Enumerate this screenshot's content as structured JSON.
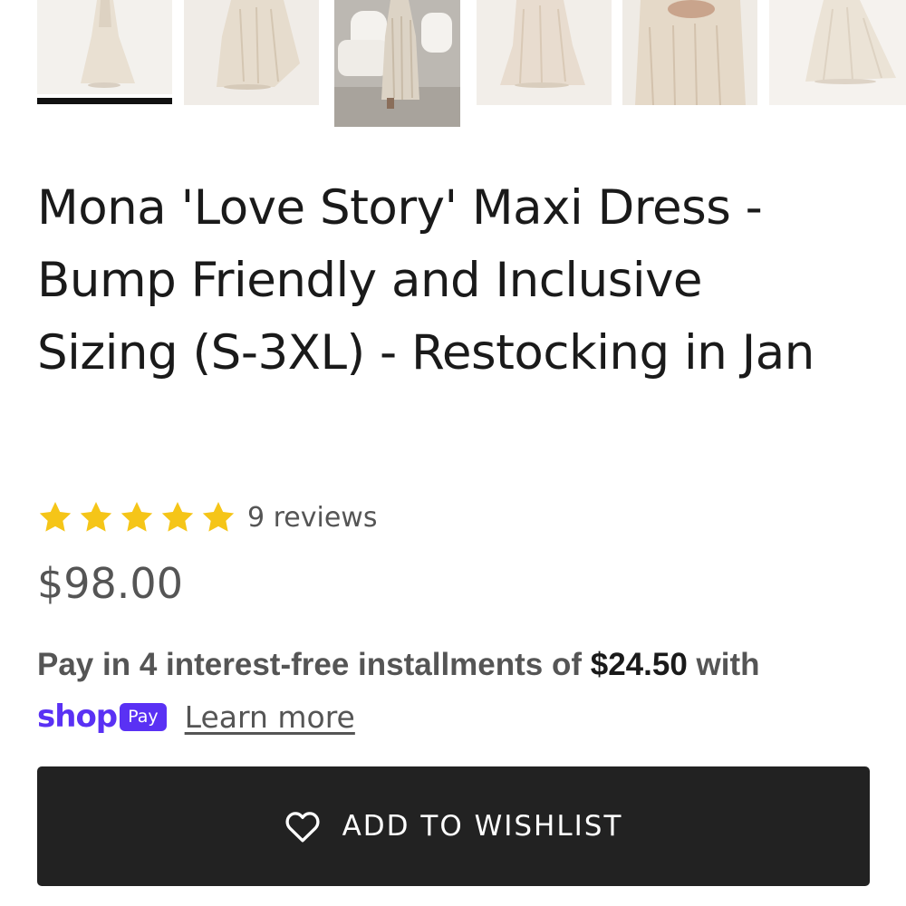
{
  "gallery": {
    "thumbnails": [
      {
        "alt": "thumbnail-1",
        "active": true
      },
      {
        "alt": "thumbnail-2",
        "active": false
      },
      {
        "alt": "thumbnail-3",
        "active": false
      },
      {
        "alt": "thumbnail-4",
        "active": false
      },
      {
        "alt": "thumbnail-5",
        "active": false
      },
      {
        "alt": "thumbnail-6",
        "active": false
      }
    ]
  },
  "product": {
    "title": "Mona 'Love Story' Maxi Dress - Bump Friendly and Inclusive Sizing (S-3XL) - Restocking in Jan",
    "rating": {
      "stars": 5,
      "max_stars": 5,
      "reviews_label": "9 reviews"
    },
    "price": "$98.00"
  },
  "installments": {
    "prefix": "Pay in 4 interest-free installments of",
    "amount": "$24.50",
    "suffix": "with",
    "shop_word": "shop",
    "pay_badge": "Pay",
    "learn_more": "Learn more"
  },
  "wishlist": {
    "label": "ADD TO WISHLIST",
    "icon": "heart-outline-icon"
  },
  "colors": {
    "star": "#f5c518",
    "shoppay": "#5a31f4",
    "button_bg": "#222222",
    "text_muted": "#555555",
    "active_indicator": "#111111"
  }
}
